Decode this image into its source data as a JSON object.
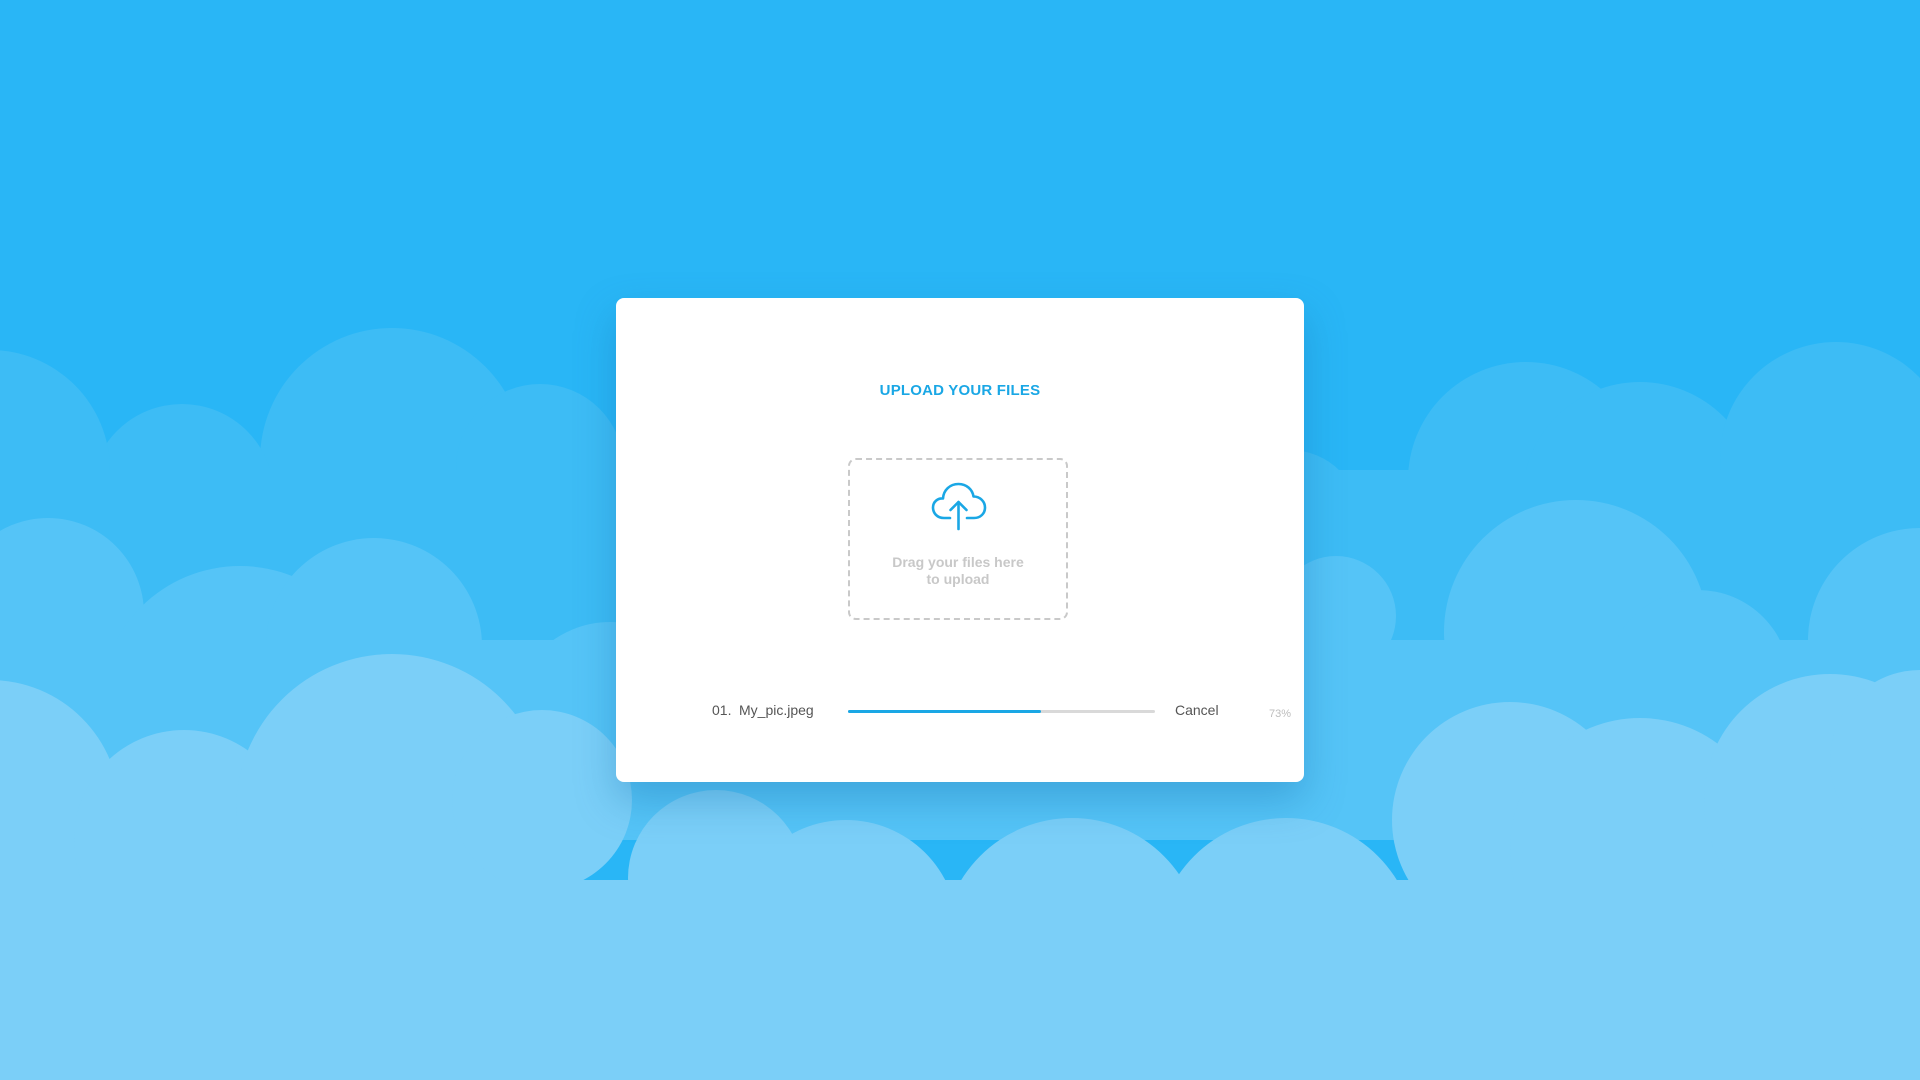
{
  "colors": {
    "background": "#29b6f6",
    "accent": "#1aa7e5",
    "cloud_back": "#3dbcf5",
    "cloud_mid": "#55c4f7",
    "cloud_front": "#7bcff8"
  },
  "modal": {
    "title": "UPLOAD YOUR FILES",
    "dropzone": {
      "icon": "cloud-upload-icon",
      "text_line1": "Drag your files here",
      "text_line2": "to upload"
    },
    "files": [
      {
        "index": "01.",
        "name": "My_pic.jpeg",
        "progress_label": "73%",
        "progress": 0.63,
        "cancel_label": "Cancel"
      }
    ]
  }
}
